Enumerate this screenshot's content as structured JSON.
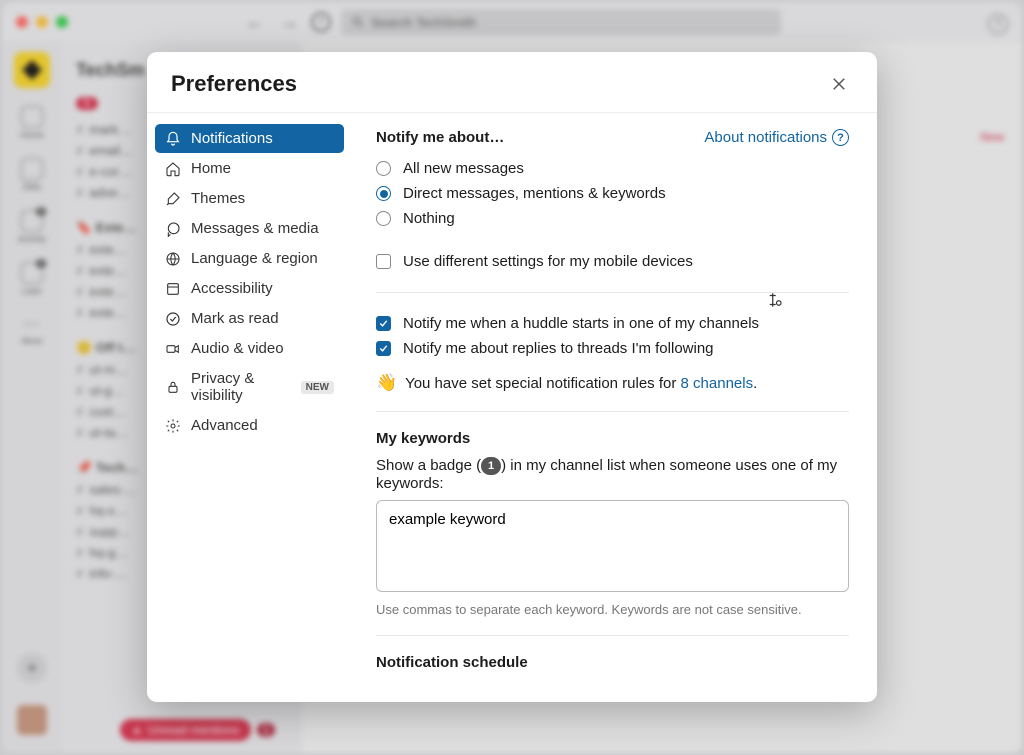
{
  "app": {
    "search_placeholder": "Search TechSmith",
    "workspace_title": "TechSm",
    "new_label": "New"
  },
  "rail": {
    "home": "Home",
    "dms": "DMs",
    "activity": "Activity",
    "later": "Later",
    "more": "More"
  },
  "sidebar_channels": [
    "mark…",
    "email…",
    "e-cor…",
    "adve…"
  ],
  "sidebar_section2": [
    "exte…",
    "exte…",
    "exte…",
    "exte…"
  ],
  "sidebar_section3": [
    "ut-m…",
    "ut-g…",
    "cust…",
    "ut-ta…"
  ],
  "sidebar_section4": [
    "sales-…",
    "hq-s…",
    "supp…",
    "hq-g…",
    "info-…"
  ],
  "unread_pill": "Unread mentions",
  "modal": {
    "title": "Preferences",
    "sidebar": {
      "notifications": "Notifications",
      "home": "Home",
      "themes": "Themes",
      "messages_media": "Messages & media",
      "language_region": "Language & region",
      "accessibility": "Accessibility",
      "mark_as_read": "Mark as read",
      "audio_video": "Audio & video",
      "privacy_visibility": "Privacy & visibility",
      "privacy_new_badge": "NEW",
      "advanced": "Advanced"
    },
    "content": {
      "notify_label": "Notify me about…",
      "about_link": "About notifications",
      "radio_all": "All new messages",
      "radio_dm": "Direct messages, mentions & keywords",
      "radio_nothing": "Nothing",
      "mobile_settings": "Use different settings for my mobile devices",
      "huddle_check": "Notify me when a huddle starts in one of my channels",
      "thread_check": "Notify me about replies to threads I'm following",
      "special_prefix": "You have set special notification rules for ",
      "special_link": "8 channels",
      "special_suffix": ".",
      "keywords_heading": "My keywords",
      "keywords_desc_pre": "Show a badge (",
      "keywords_badge": "1",
      "keywords_desc_post": ") in my channel list when someone uses one of my keywords:",
      "keywords_value": "example keyword",
      "keywords_hint": "Use commas to separate each keyword. Keywords are not case sensitive.",
      "schedule_heading": "Notification schedule"
    }
  }
}
